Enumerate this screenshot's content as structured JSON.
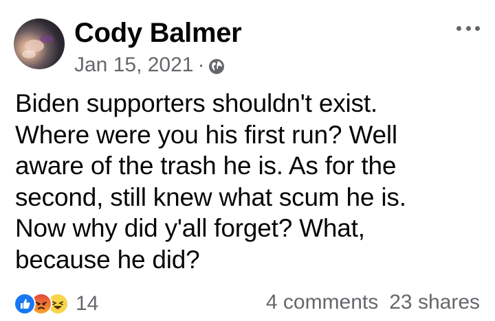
{
  "post": {
    "author": "Cody Balmer",
    "date": "Jan 15, 2021",
    "separator": "·",
    "privacy_icon": "globe-icon",
    "body": "Biden supporters shouldn't exist.\nWhere were you his first run? Well\naware of the trash he is. As for the\nsecond, still knew what scum he is.\nNow why did y'all forget? What,\nbecause he did?"
  },
  "reactions": {
    "icons": [
      "like-reaction-icon",
      "angry-reaction-icon",
      "haha-reaction-icon"
    ],
    "count": "14"
  },
  "stats": {
    "comments": "4 comments",
    "shares": "23 shares"
  },
  "colors": {
    "text": "#050505",
    "secondary": "#65676b",
    "like_blue": "#1877f2"
  }
}
